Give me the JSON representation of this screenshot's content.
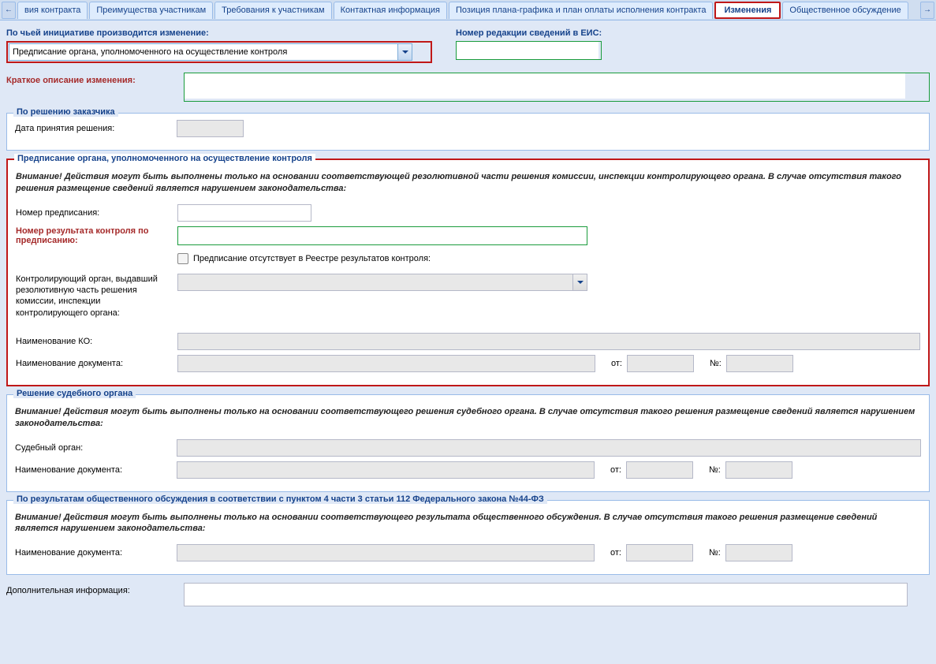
{
  "tabs": {
    "scroll_left": "←",
    "scroll_right": "→",
    "items": [
      "вия контракта",
      "Преимущества участникам",
      "Требования к участникам",
      "Контактная информация",
      "Позиция плана-графика и план оплаты исполнения контракта",
      "Изменения",
      "Общественное обсуждение"
    ],
    "active_index": 5
  },
  "top": {
    "initiative_label": "По чьей инициативе производится изменение:",
    "initiative_value": "Предписание органа, уполномоченного на осуществление контроля",
    "edition_label": "Номер редакции сведений в ЕИС:",
    "edition_value": ""
  },
  "short_desc": {
    "label": "Краткое описание изменения:",
    "value": ""
  },
  "customer_section": {
    "legend": "По решению заказчика",
    "decision_date_label": "Дата принятия решения:",
    "decision_date_value": ""
  },
  "order_section": {
    "legend": "Предписание органа, уполномоченного на осуществление контроля",
    "warning": "Внимание! Действия могут быть выполнены только на основании соответствующей резолютивной части решения комиссии, инспекции контролирующего органа. В случае отсутствия такого решения размещение сведений является нарушением законодательства:",
    "order_num_label": "Номер предписания:",
    "order_num_value": "",
    "result_num_label": "Номер результата контроля по предписанию:",
    "result_num_value": "",
    "checkbox_label": "Предписание отсутствует в Реестре результатов контроля:",
    "controlling_org_label": "Контролирующий орган, выдавший резолютивную часть решения комиссии, инспекции контролирующего органа:",
    "controlling_org_value": "",
    "ko_name_label": "Наименование КО:",
    "ko_name_value": "",
    "doc_name_label": "Наименование документа:",
    "doc_name_value": "",
    "from_label": "от:",
    "from_value": "",
    "num_label": "№:",
    "num_value": ""
  },
  "court_section": {
    "legend": "Решение судебного органа",
    "warning": "Внимание! Действия могут быть выполнены только на основании соответствующего решения судебного органа. В случае отсутствия такого решения размещение сведений является нарушением законодательства:",
    "court_label": "Судебный орган:",
    "court_value": "",
    "doc_name_label": "Наименование документа:",
    "doc_name_value": "",
    "from_label": "от:",
    "from_value": "",
    "num_label": "№:",
    "num_value": ""
  },
  "public_section": {
    "legend": "По результатам общественного обсуждения в соответствии с пунктом 4 части 3 статьи 112 Федерального закона №44-ФЗ",
    "warning": "Внимание! Действия могут быть выполнены только на основании соответствующего результата общественного обсуждения. В случае отсутствия такого решения размещение сведений является нарушением законодательства:",
    "doc_name_label": "Наименование документа:",
    "doc_name_value": "",
    "from_label": "от:",
    "from_value": "",
    "num_label": "№:",
    "num_value": ""
  },
  "additional": {
    "label": "Дополнительная информация:",
    "value": ""
  }
}
